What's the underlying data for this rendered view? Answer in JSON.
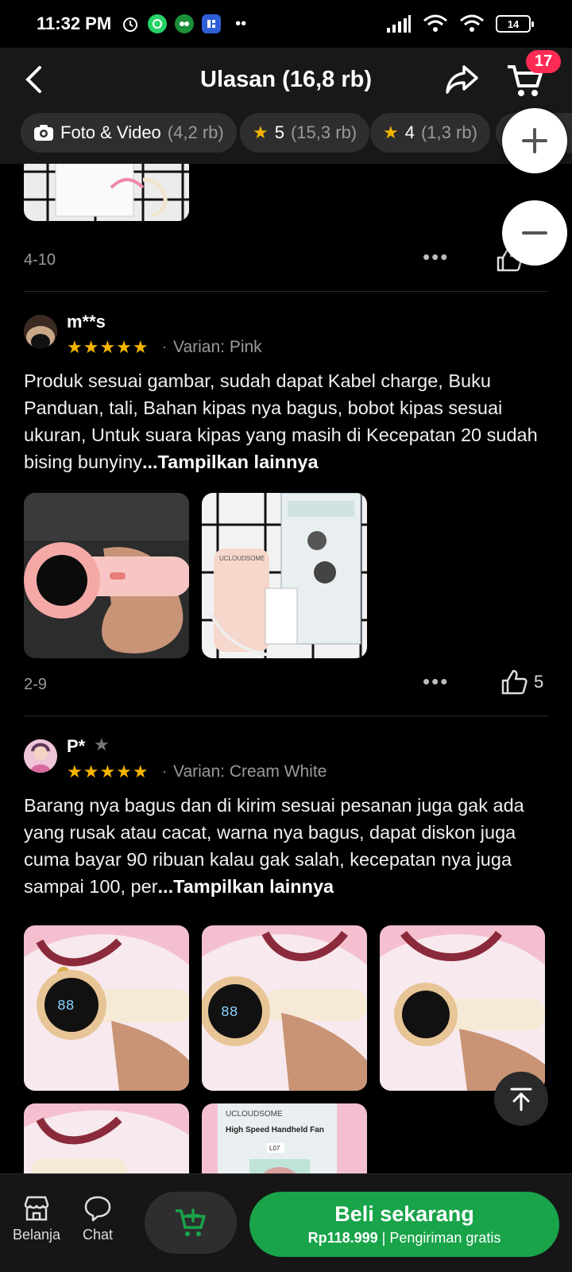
{
  "status": {
    "time": "11:32 PM",
    "battery": "14"
  },
  "header": {
    "title": "Ulasan (16,8 rb)",
    "cart_count": "17"
  },
  "filters": [
    {
      "label": "Foto & Video",
      "count": "(4,2 rb)",
      "icon": "camera-icon"
    },
    {
      "label": "5",
      "count": "(15,3 rb)",
      "icon": "star-icon"
    },
    {
      "label": "4",
      "count": "(1,3 rb)",
      "icon": "star-icon"
    }
  ],
  "prev_review": {
    "date": "4-10"
  },
  "reviews": [
    {
      "user": "m**s",
      "rating": 5,
      "variant": "Varian: Pink",
      "text": "Produk sesuai gambar, sudah dapat Kabel charge, Buku Panduan, tali, Bahan kipas nya bagus, bobot kipas sesuai ukuran, Untuk suara kipas yang masih di Kecepatan 20 sudah bising bunyiny",
      "more": "...Tampilkan lainnya",
      "date": "2-9",
      "likes": "5"
    },
    {
      "user": "P*",
      "rating": 5,
      "variant": "Varian: Cream White",
      "text": "Barang nya bagus dan di kirim sesuai pesanan juga gak ada yang rusak atau cacat, warna nya bagus, dapat diskon juga cuma bayar 90 ribuan kalau gak salah, kecepatan nya juga sampai 100, per",
      "more": "...Tampilkan lainnya"
    }
  ],
  "photo_text": {
    "brand": "UCLOUDSOME",
    "product": "High Speed Handheld Fan",
    "led": "88",
    "box_code": "L07"
  },
  "bottom": {
    "shop_label": "Belanja",
    "chat_label": "Chat",
    "buy_label": "Beli sekarang",
    "price": "Rp118.999",
    "shipping": "Pengiriman gratis"
  },
  "colors": {
    "accent_green": "#19a44a",
    "star": "#f5b400",
    "badge": "#fe2c55"
  }
}
